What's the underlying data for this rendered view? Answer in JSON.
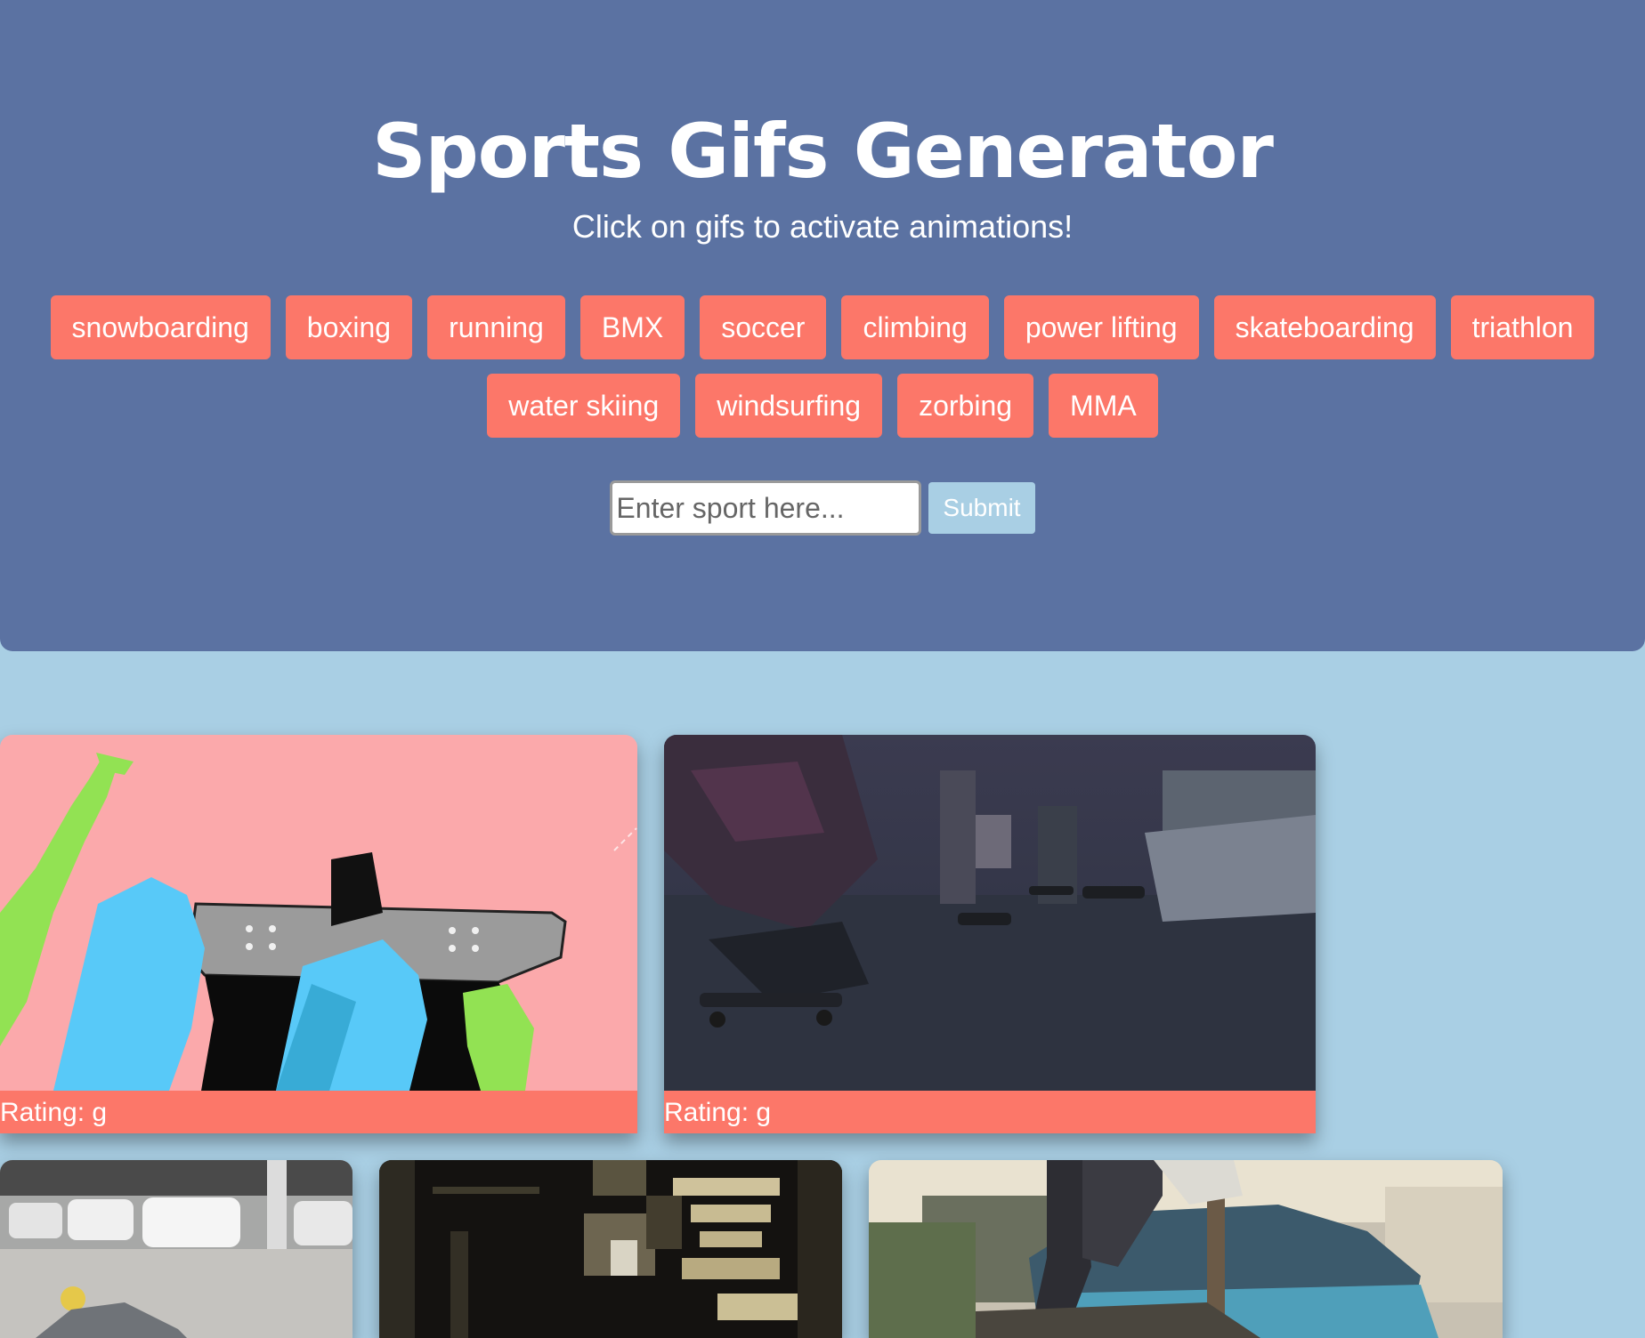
{
  "header": {
    "title": "Sports Gifs Generator",
    "subtitle": "Click on gifs to activate animations!"
  },
  "sports_buttons_row1": [
    "snowboarding",
    "boxing",
    "running",
    "BMX",
    "soccer",
    "climbing",
    "power lifting",
    "skateboarding",
    "triathlon"
  ],
  "sports_buttons_row2": [
    "water skiing",
    "windsurfing",
    "zorbing",
    "MMA"
  ],
  "search": {
    "placeholder": "Enter sport here...",
    "submit_label": "Submit"
  },
  "gifs": [
    {
      "rating": "Rating: g",
      "content": "cartoon skateboard"
    },
    {
      "rating": "Rating: g",
      "content": "skaters on street"
    },
    {
      "rating": "",
      "content": "parking lot"
    },
    {
      "rating": "",
      "content": "dark pixelated clip"
    },
    {
      "rating": "",
      "content": "skater near blue car"
    }
  ],
  "colors": {
    "header_bg": "#5b72a2",
    "page_bg": "#a9cfe4",
    "button_bg": "#fc7769",
    "rating_bar": "#fc7769",
    "submit_bg": "#a9cfe4"
  }
}
